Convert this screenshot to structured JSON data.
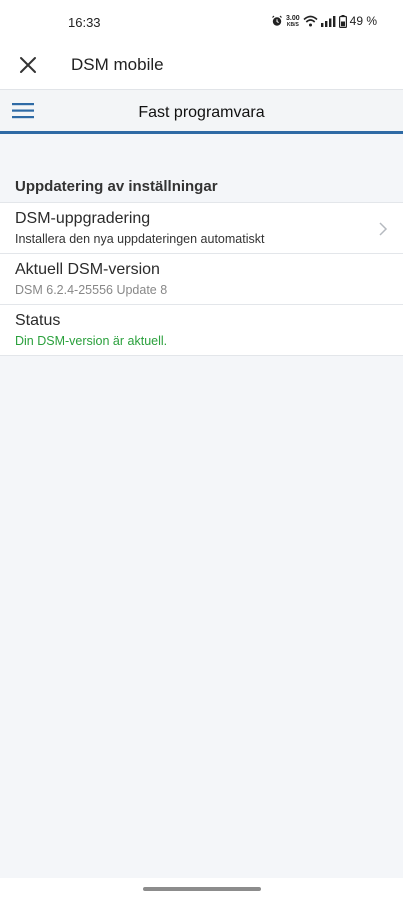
{
  "status_bar": {
    "time": "16:33",
    "net_speed_value": "3.00",
    "net_speed_unit": "KB/S",
    "battery": "49 %",
    "icons": [
      "alarm-icon",
      "wifi-icon",
      "signal-icon",
      "battery-icon"
    ]
  },
  "appbar": {
    "title": "DSM mobile",
    "close_icon": "close-icon"
  },
  "subbar": {
    "title": "Fast programvara",
    "menu_icon": "hamburger-menu-icon",
    "accent_color": "#2e6aa5"
  },
  "section": {
    "header": "Uppdatering av inställningar",
    "rows": [
      {
        "title": "DSM-uppgradering",
        "subtitle": "Installera den nya uppdateringen automatiskt"
      },
      {
        "title": "Aktuell DSM-version",
        "subtitle": "DSM 6.2.4-25556 Update 8"
      },
      {
        "title": "Status",
        "subtitle": "Din DSM-version är aktuell."
      }
    ]
  },
  "colors": {
    "status_ok": "#2aa03c"
  }
}
